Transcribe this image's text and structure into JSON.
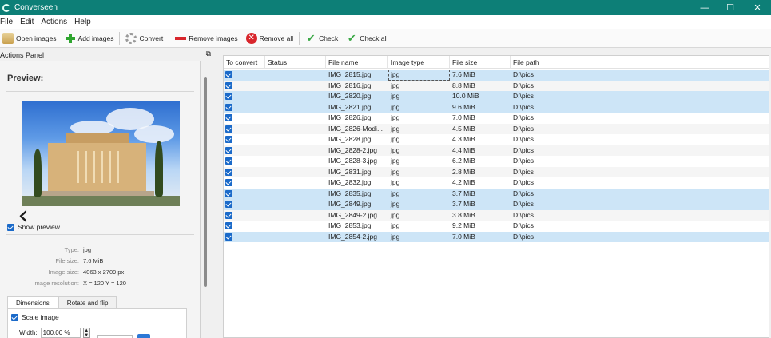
{
  "window": {
    "title": "Converseen",
    "minimize": "—",
    "maximize": "☐",
    "close": "✕"
  },
  "menu": [
    "File",
    "Edit",
    "Actions",
    "Help"
  ],
  "toolbar": {
    "open_images": "Open images",
    "add_images": "Add images",
    "convert": "Convert",
    "remove_images": "Remove images",
    "remove_all": "Remove all",
    "check": "Check",
    "check_all": "Check all"
  },
  "actions_panel": {
    "title": "Actions Panel",
    "float_icon": "⧉",
    "preview_title": "Preview:",
    "show_preview_label": "Show preview",
    "show_preview_checked": true,
    "info": [
      {
        "key": "Type:",
        "value": "jpg"
      },
      {
        "key": "File size:",
        "value": "7.6 MiB"
      },
      {
        "key": "Image size:",
        "value": "4063 x 2709 px"
      },
      {
        "key": "Image resolution:",
        "value": "X = 120 Y = 120"
      }
    ],
    "tabs": [
      "Dimensions",
      "Rotate and flip"
    ],
    "active_tab": 0,
    "scale_image_label": "Scale image",
    "width_label": "Width:",
    "width_value": "100.00 %"
  },
  "nav": {
    "prev_icon": "‹",
    "next_icon": "›"
  },
  "table": {
    "columns": [
      "To convert",
      "Status",
      "File name",
      "Image type",
      "File size",
      "File path"
    ],
    "rows": [
      {
        "checked": true,
        "status": "",
        "name": "IMG_2815.jpg",
        "type": "jpg",
        "size": "7.6 MiB",
        "path": "D:\\pics",
        "selected": true
      },
      {
        "checked": true,
        "status": "",
        "name": "IMG_2816.jpg",
        "type": "jpg",
        "size": "8.8 MiB",
        "path": "D:\\pics",
        "selected": false
      },
      {
        "checked": true,
        "status": "",
        "name": "IMG_2820.jpg",
        "type": "jpg",
        "size": "10.0 MiB",
        "path": "D:\\pics",
        "selected": true
      },
      {
        "checked": true,
        "status": "",
        "name": "IMG_2821.jpg",
        "type": "jpg",
        "size": "9.6 MiB",
        "path": "D:\\pics",
        "selected": true
      },
      {
        "checked": true,
        "status": "",
        "name": "IMG_2826.jpg",
        "type": "jpg",
        "size": "7.0 MiB",
        "path": "D:\\pics",
        "selected": false
      },
      {
        "checked": true,
        "status": "",
        "name": "IMG_2826-Modi...",
        "type": "jpg",
        "size": "4.5 MiB",
        "path": "D:\\pics",
        "selected": false
      },
      {
        "checked": true,
        "status": "",
        "name": "IMG_2828.jpg",
        "type": "jpg",
        "size": "4.3 MiB",
        "path": "D:\\pics",
        "selected": false
      },
      {
        "checked": true,
        "status": "",
        "name": "IMG_2828-2.jpg",
        "type": "jpg",
        "size": "4.4 MiB",
        "path": "D:\\pics",
        "selected": false
      },
      {
        "checked": true,
        "status": "",
        "name": "IMG_2828-3.jpg",
        "type": "jpg",
        "size": "6.2 MiB",
        "path": "D:\\pics",
        "selected": false
      },
      {
        "checked": true,
        "status": "",
        "name": "IMG_2831.jpg",
        "type": "jpg",
        "size": "2.8 MiB",
        "path": "D:\\pics",
        "selected": false
      },
      {
        "checked": true,
        "status": "",
        "name": "IMG_2832.jpg",
        "type": "jpg",
        "size": "4.2 MiB",
        "path": "D:\\pics",
        "selected": false
      },
      {
        "checked": true,
        "status": "",
        "name": "IMG_2835.jpg",
        "type": "jpg",
        "size": "3.7 MiB",
        "path": "D:\\pics",
        "selected": true
      },
      {
        "checked": true,
        "status": "",
        "name": "IMG_2849.jpg",
        "type": "jpg",
        "size": "3.7 MiB",
        "path": "D:\\pics",
        "selected": true
      },
      {
        "checked": true,
        "status": "",
        "name": "IMG_2849-2.jpg",
        "type": "jpg",
        "size": "3.8 MiB",
        "path": "D:\\pics",
        "selected": false
      },
      {
        "checked": true,
        "status": "",
        "name": "IMG_2853.jpg",
        "type": "jpg",
        "size": "9.2 MiB",
        "path": "D:\\pics",
        "selected": false
      },
      {
        "checked": true,
        "status": "",
        "name": "IMG_2854-2.jpg",
        "type": "jpg",
        "size": "7.0 MiB",
        "path": "D:\\pics",
        "selected": true
      }
    ]
  },
  "colors": {
    "titlebar": "#0d7f77",
    "selection": "#cde5f7",
    "checkbox": "#1b6ac9"
  }
}
